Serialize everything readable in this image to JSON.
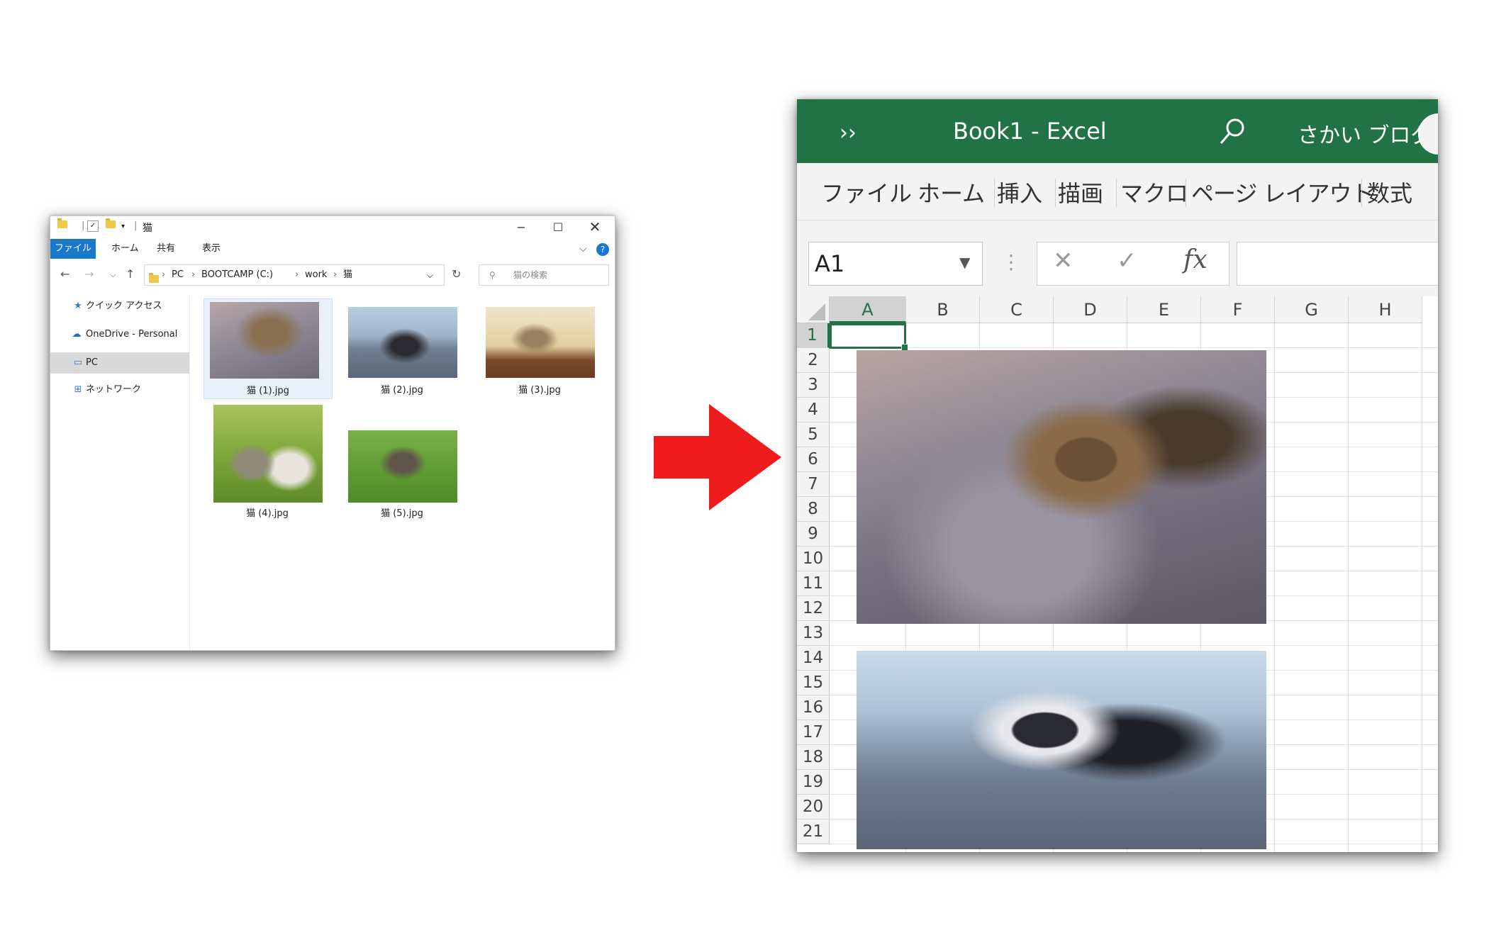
{
  "explorer": {
    "title": "猫",
    "ribbon_tabs": [
      "ファイル",
      "ホーム",
      "共有",
      "表示"
    ],
    "breadcrumb": [
      "PC",
      "BOOTCAMP (C:)",
      "work",
      "猫"
    ],
    "search_placeholder": "猫の検索",
    "nav_items": [
      "クイック アクセス",
      "OneDrive - Personal",
      "PC",
      "ネットワーク"
    ],
    "files": [
      "猫 (1).jpg",
      "猫 (2).jpg",
      "猫 (3).jpg",
      "猫 (4).jpg",
      "猫 (5).jpg"
    ]
  },
  "excel": {
    "doc_title": "Book1  -  Excel",
    "user_name": "さかい ブログ",
    "ribbon_tabs": [
      "ファイル",
      "ホーム",
      "挿入",
      "描画",
      "マクロ",
      "ページ レイアウト",
      "数式"
    ],
    "name_box": "A1",
    "fx_label": "fx",
    "columns": [
      "A",
      "B",
      "C",
      "D",
      "E",
      "F",
      "G",
      "H"
    ],
    "rows": [
      "1",
      "2",
      "3",
      "4",
      "5",
      "6",
      "7",
      "8",
      "9",
      "10",
      "11",
      "12",
      "13",
      "14",
      "15",
      "16",
      "17",
      "18",
      "19",
      "20",
      "21"
    ],
    "active_cell": "A1",
    "accent_color": "#217346"
  },
  "arrow_color": "#ee1c1c"
}
